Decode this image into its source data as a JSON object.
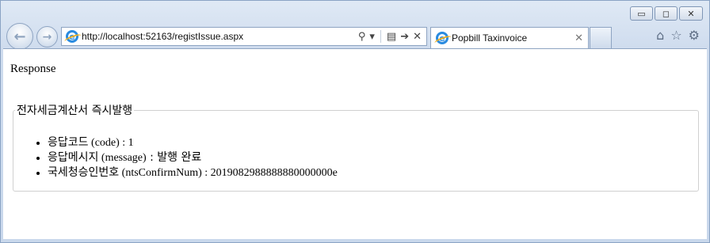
{
  "browser": {
    "url": "http://localhost:52163/registIssue.aspx",
    "tab_title": "Popbill Taxinvoice",
    "window_controls": [
      "minimize",
      "maximize",
      "close"
    ],
    "toolbar_icons": [
      "home-icon",
      "star-icon",
      "gear-icon"
    ]
  },
  "page": {
    "title": "Response",
    "section_legend": "전자세금계산서 즉시발행",
    "items": [
      {
        "label": "응답코드",
        "key": "(code)",
        "value": " : 1"
      },
      {
        "label": "응답메시지",
        "key": "(message)",
        "value_ko": " : 발행 완료"
      },
      {
        "label": "국세청승인번호",
        "key": "(ntsConfirmNum)",
        "value": " : 2019082988888880000000e"
      }
    ]
  }
}
